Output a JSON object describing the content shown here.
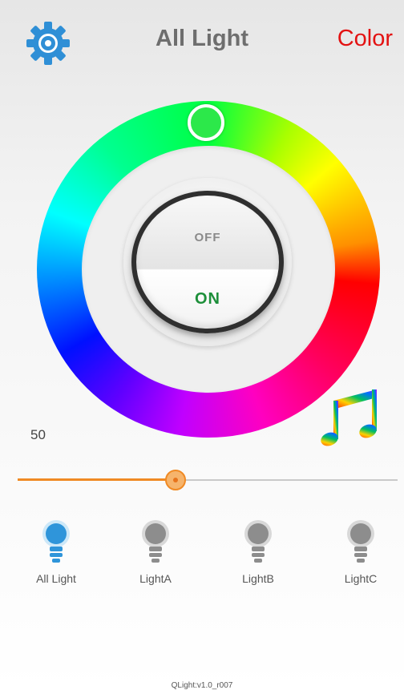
{
  "header": {
    "title": "All Light",
    "mode_label": "Color",
    "settings_icon": "gear-icon",
    "accent_blue": "#2f8fd6",
    "mode_color": "#e31212"
  },
  "color_wheel": {
    "selected_color": "#2ce84a"
  },
  "power_switch": {
    "off_label": "OFF",
    "on_label": "ON",
    "state": "on"
  },
  "music_icon": "music-note-icon",
  "brightness": {
    "value_label": "50",
    "value": 50,
    "max": 100,
    "color": "#f08a24"
  },
  "lights": [
    {
      "label": "All Light",
      "icon": "bulb-icon",
      "active": true
    },
    {
      "label": "LightA",
      "icon": "bulb-icon",
      "active": false
    },
    {
      "label": "LightB",
      "icon": "bulb-icon",
      "active": false
    },
    {
      "label": "LightC",
      "icon": "bulb-icon",
      "active": false
    }
  ],
  "version": "QLight:v1.0_r007"
}
